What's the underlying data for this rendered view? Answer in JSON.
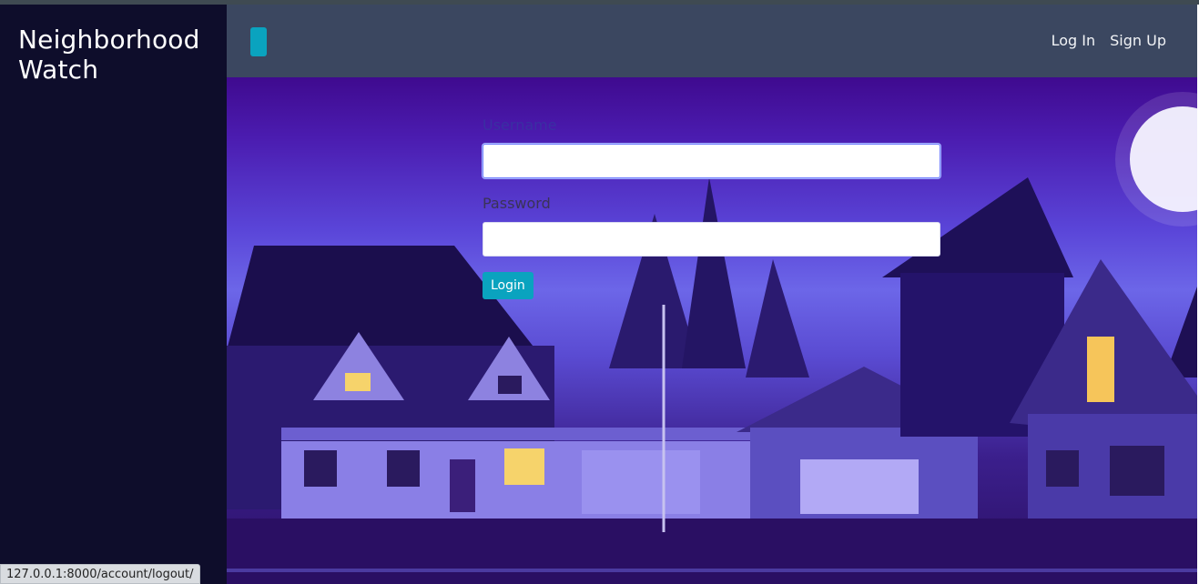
{
  "brand": {
    "line1": "Neighborhood",
    "line2": "Watch"
  },
  "navbar": {
    "toggler_color": "#0aa3bf",
    "links": [
      {
        "label": "Log In"
      },
      {
        "label": "Sign Up"
      }
    ]
  },
  "form": {
    "username_label": "Username",
    "username_value": "",
    "password_label": "Password",
    "password_value": "",
    "submit_label": "Login"
  },
  "status_bar": {
    "url": "127.0.0.1:8000/account/logout/"
  },
  "colors": {
    "sidebar": "#0e0d2b",
    "navbar": "#3b4760",
    "accent": "#0aa3bf"
  }
}
